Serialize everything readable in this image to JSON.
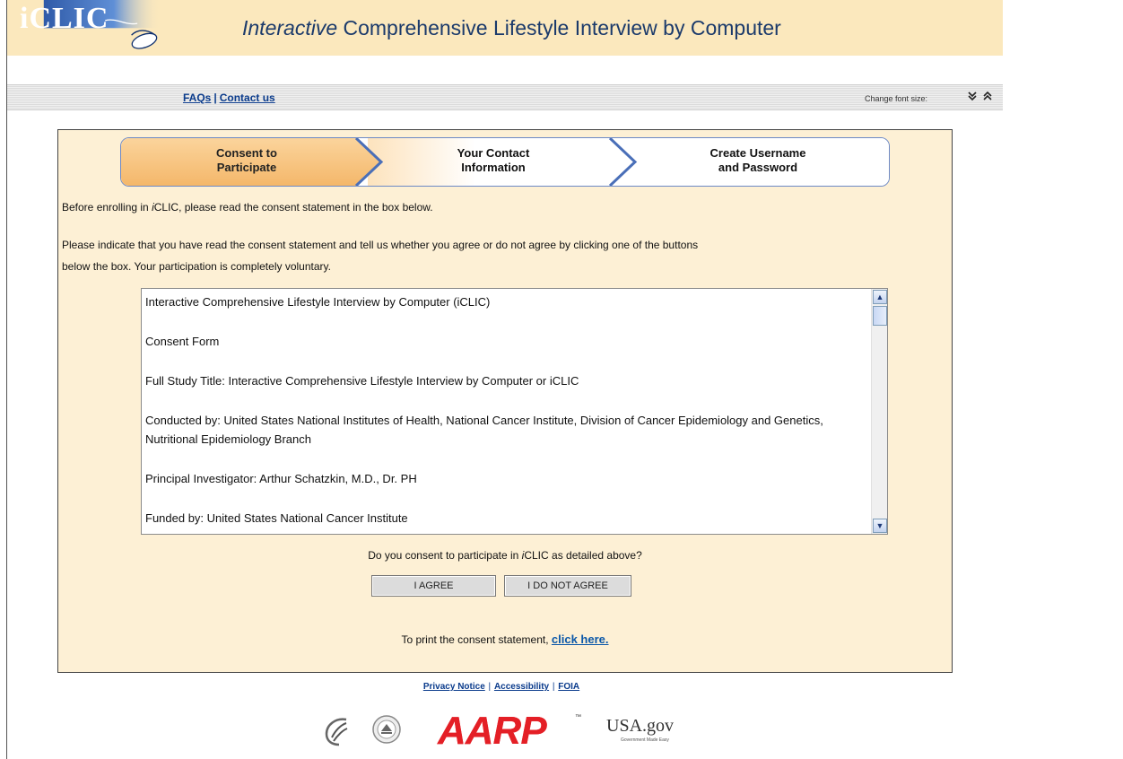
{
  "header": {
    "logo_text": "iCLIC",
    "title_italic": "Interactive",
    "title_rest": " Comprehensive Lifestyle Interview by Computer"
  },
  "nav": {
    "faqs": "FAQs",
    "separator": "|",
    "contact": "Contact us",
    "font_size_label": "Change font size:",
    "decrease_icon": "⌄",
    "increase_icon": "⌃"
  },
  "steps": [
    {
      "line1": "Consent to",
      "line2": "Participate",
      "active": true
    },
    {
      "line1": "Your Contact",
      "line2": "Information",
      "active": false
    },
    {
      "line1": "Create Username",
      "line2": "and Password",
      "active": false
    }
  ],
  "intro": {
    "line1_pre": "Before enrolling in ",
    "line1_italic": "i",
    "line1_post": "CLIC, please read the consent statement in the box below.",
    "line2": "Please indicate that you have read the consent statement and tell us whether you agree or do not agree by clicking one of the buttons",
    "line3": "below the box. Your participation is completely voluntary."
  },
  "consent": {
    "paragraphs": [
      "Interactive Comprehensive Lifestyle Interview by Computer (iCLIC)",
      "Consent Form",
      "Full Study Title: Interactive Comprehensive Lifestyle Interview by Computer or iCLIC",
      "Conducted by: United States National Institutes of Health, National Cancer Institute, Division of Cancer Epidemiology and Genetics, Nutritional Epidemiology Branch",
      "Principal Investigator:  Arthur Schatzkin, M.D., Dr. PH",
      "Funded by: United States National Cancer Institute"
    ]
  },
  "question": {
    "pre": "Do you consent to participate in ",
    "italic": "i",
    "post": "CLIC as detailed above?"
  },
  "buttons": {
    "agree": "I AGREE",
    "disagree": "I DO NOT AGREE"
  },
  "print": {
    "text": "To print the consent statement, ",
    "link": "click here."
  },
  "footer": {
    "privacy": "Privacy Notice",
    "accessibility": "Accessibility",
    "foia": "FOIA",
    "separator": "|",
    "aarp": "AARP",
    "aarp_tm": "™",
    "usa": "USA.gov",
    "usa_sub": "Government Made Easy"
  },
  "colors": {
    "header_bg": "#fbe8bd",
    "panel_bg": "#fdf0d5",
    "active_step": "#f7c57e",
    "step_border": "#6d89c5",
    "link": "#0a3b8c",
    "aarp_red": "#e41f26"
  }
}
